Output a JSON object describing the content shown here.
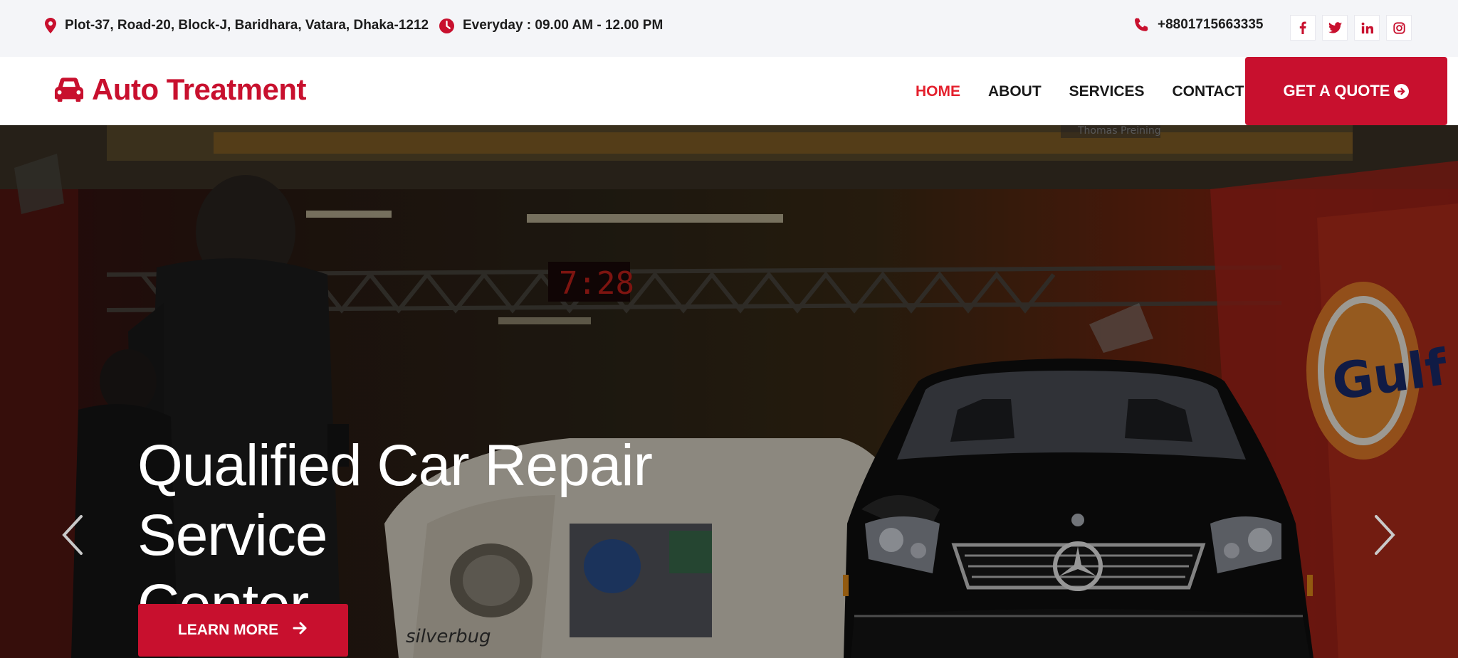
{
  "topbar": {
    "address": "Plot-37, Road-20, Block-J, Baridhara, Vatara, Dhaka-1212",
    "hours": "Everyday : 09.00 AM - 12.00 PM",
    "phone": "+8801715663335",
    "socials": [
      {
        "icon": "facebook-icon",
        "glyph": "f"
      },
      {
        "icon": "twitter-icon",
        "glyph": "t"
      },
      {
        "icon": "linkedin-icon",
        "glyph": "in"
      },
      {
        "icon": "instagram-icon",
        "glyph": "ig"
      }
    ]
  },
  "brand": {
    "name": "Auto Treatment",
    "icon": "car-icon",
    "accent_color": "#c8102e"
  },
  "nav": {
    "items": [
      {
        "label": "HOME",
        "active": true
      },
      {
        "label": "ABOUT",
        "active": false
      },
      {
        "label": "SERVICES",
        "active": false
      },
      {
        "label": "CONTACT",
        "active": false
      }
    ],
    "quote_button": "GET A QUOTE"
  },
  "hero": {
    "title_line1": "Qualified Car Repair Service",
    "title_line2": "Center",
    "cta": "LEARN MORE",
    "clock_text": "7:28",
    "sign_text": "Gulf",
    "name_plate": "Thomas Preining",
    "car_label": "silverbug"
  }
}
